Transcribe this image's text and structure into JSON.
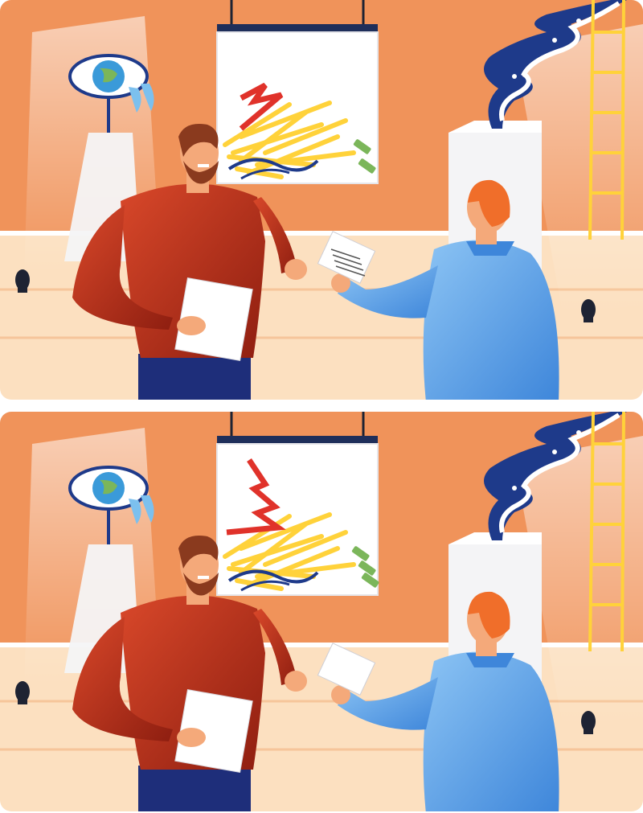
{
  "puzzle": {
    "type": "spot-the-difference",
    "panels": [
      {
        "id": "top",
        "variant": "original"
      },
      {
        "id": "bottom",
        "variant": "modified"
      }
    ],
    "differences": [
      {
        "name": "painting-green-marks",
        "top_count": 2,
        "bottom_count": 3
      },
      {
        "name": "handout-lines",
        "top_present": true,
        "bottom_present": false
      },
      {
        "name": "lightning-bolt",
        "top_shape": "short",
        "bottom_shape": "tall"
      }
    ]
  },
  "colors": {
    "wall": "#F0935A",
    "floor": "#FCE0C0",
    "floor_line": "#F6C59A",
    "red_sweater": "#C2391E",
    "blue_shirt": "#5FA6E6",
    "jeans": "#1E2E7A",
    "hair_orange": "#F06E2A",
    "hair_brown": "#8A3A1E",
    "yellow": "#FFD23A",
    "ink_blue": "#1E3A8A",
    "green": "#7BB65A",
    "lightning": "#E0322A",
    "pedestal": "#F4F4F6"
  },
  "icons": [
    "eye-globe-sculpture",
    "smoke-swirl-sculpture",
    "ladder",
    "spotlight"
  ]
}
